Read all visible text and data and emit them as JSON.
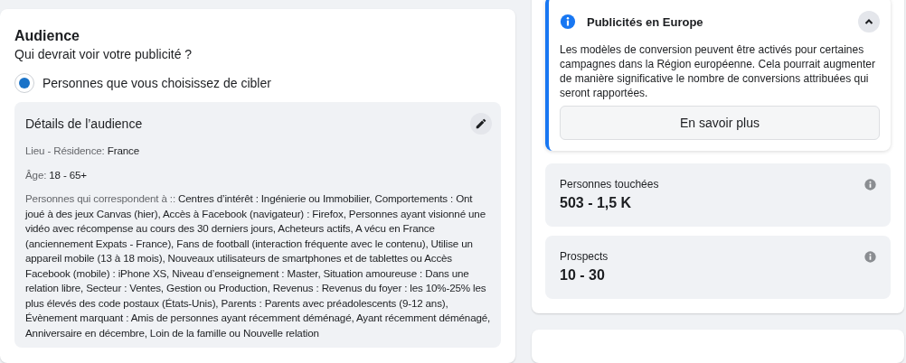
{
  "audience": {
    "title": "Audience",
    "subtitle": "Qui devrait voir votre publicité ?",
    "options": [
      {
        "label": "Personnes que vous choisissez de cibler",
        "selected": true
      }
    ],
    "details": {
      "title": "Détails de l’audience",
      "items": [
        {
          "label": "Lieu - Résidence:",
          "value": "France"
        },
        {
          "label": "Âge:",
          "value": "18 - 65+"
        },
        {
          "label": "Personnes qui correspondent à ::",
          "value": "Centres d’intérêt : Ingénierie ou Immobilier, Comportements : Ont joué à des jeux Canvas (hier), Accès à Facebook (navigateur) : Firefox, Personnes ayant visionné une vidéo avec récompense au cours des 30 derniers jours, Acheteurs actifs, A vécu en France (anciennement Expats - France), Fans de football (interaction fréquente avec le contenu), Utilise un appareil mobile (13 à 18 mois), Nouveaux utilisateurs de smartphones et de tablettes ou Accès Facebook (mobile) : iPhone XS, Niveau d’enseignement : Master, Situation amoureuse : Dans une relation libre, Secteur : Ventes, Gestion ou Production, Revenus : Revenus du foyer : les 10%-25% les plus élevés des code postaux (États-Unis), Parents : Parents avec préadolescents (9-12 ans), Évènement marquant : Amis de personnes ayant récemment déménagé, Ayant récemment déménagé, Anniversaire en décembre, Loin de la famille ou Nouvelle relation"
        }
      ]
    }
  },
  "notice": {
    "title": "Publicités en Europe",
    "expanded": true,
    "body": "Les modèles de conversion peuvent être activés pour certaines campagnes dans la Région européenne. Cela pourrait augmenter de manière significative le nombre de conversions attribuées qui seront rapportées.",
    "button": "En savoir plus"
  },
  "estimates": [
    {
      "label": "Personnes touchées",
      "value": "503 - 1,5 K"
    },
    {
      "label": "Prospects",
      "value": "10 - 30"
    }
  ]
}
